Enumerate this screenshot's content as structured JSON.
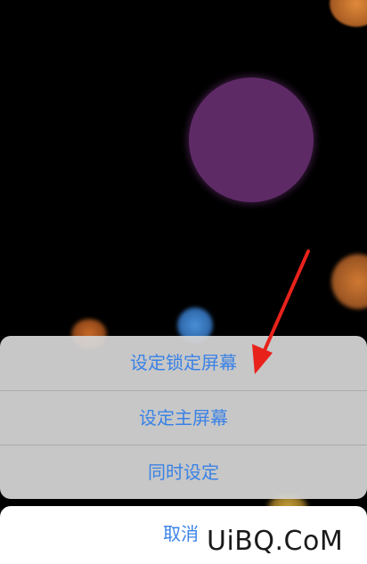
{
  "action_sheet": {
    "actions": [
      {
        "label": "设定锁定屏幕"
      },
      {
        "label": "设定主屏幕"
      },
      {
        "label": "同时设定"
      }
    ],
    "cancel_label": "取消",
    "accent_color": "#3a82e6"
  },
  "watermark": {
    "text": "UiBQ.CoM"
  },
  "annotation": {
    "arrow_color": "#e8221b"
  }
}
